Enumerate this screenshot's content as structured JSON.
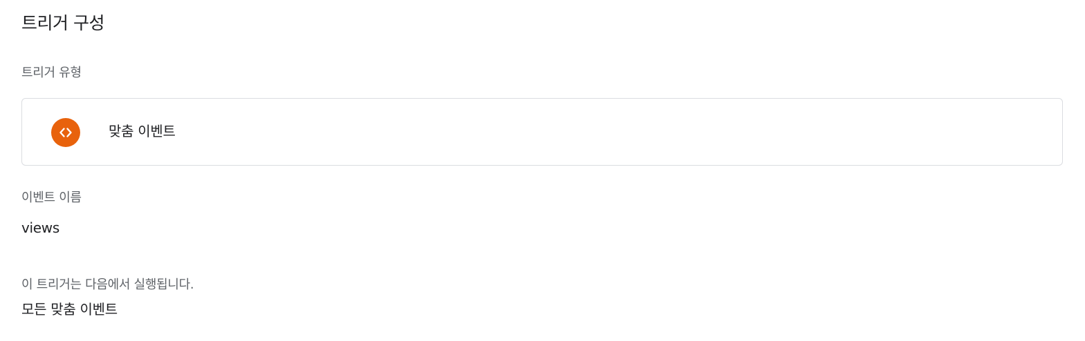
{
  "header": {
    "title": "트리거 구성"
  },
  "trigger_type": {
    "label": "트리거 유형",
    "selected": {
      "name": "맞춤 이벤트",
      "icon": "code-brackets-icon",
      "icon_color": "#e8620c"
    }
  },
  "event_name": {
    "label": "이벤트 이름",
    "value": "views"
  },
  "fires_on": {
    "label": "이 트리거는 다음에서 실행됩니다.",
    "value": "모든 맞춤 이벤트"
  }
}
